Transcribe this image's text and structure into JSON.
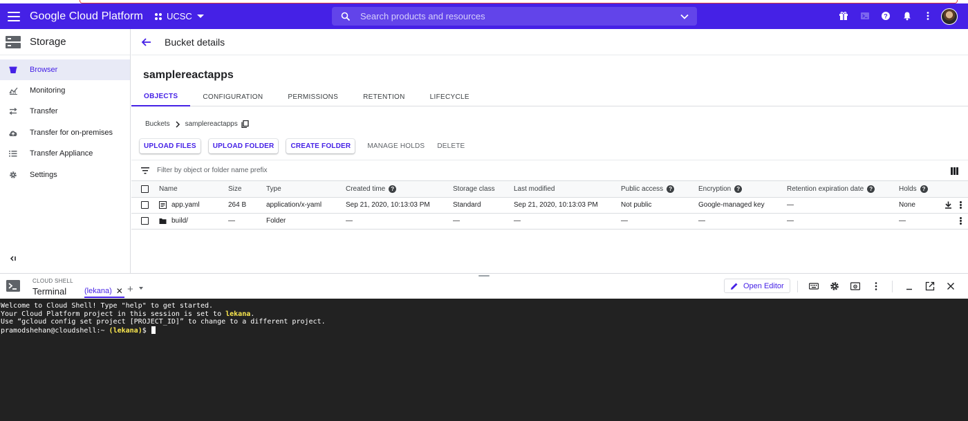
{
  "header": {
    "brand": "Google Cloud Platform",
    "project": "UCSC",
    "search_placeholder": "Search products and resources"
  },
  "sidebar": {
    "title": "Storage",
    "items": [
      {
        "label": "Browser",
        "icon": "bucket-icon",
        "active": true
      },
      {
        "label": "Monitoring",
        "icon": "chart-icon",
        "active": false
      },
      {
        "label": "Transfer",
        "icon": "transfer-icon",
        "active": false
      },
      {
        "label": "Transfer for on-premises",
        "icon": "cloud-upload-icon",
        "active": false
      },
      {
        "label": "Transfer Appliance",
        "icon": "list-icon",
        "active": false
      },
      {
        "label": "Settings",
        "icon": "gear-icon",
        "active": false
      }
    ]
  },
  "main": {
    "page_title": "Bucket details",
    "bucket_name": "samplereactapps",
    "tabs": [
      "OBJECTS",
      "CONFIGURATION",
      "PERMISSIONS",
      "RETENTION",
      "LIFECYCLE"
    ],
    "breadcrumb": {
      "root": "Buckets",
      "current": "samplereactapps"
    },
    "actions": {
      "upload_files": "UPLOAD FILES",
      "upload_folder": "UPLOAD FOLDER",
      "create_folder": "CREATE FOLDER",
      "manage_holds": "MANAGE HOLDS",
      "delete": "DELETE"
    },
    "filter_placeholder": "Filter by object or folder name prefix",
    "table": {
      "columns": {
        "name": "Name",
        "size": "Size",
        "type": "Type",
        "created": "Created time",
        "storage_class": "Storage class",
        "last_modified": "Last modified",
        "public_access": "Public access",
        "encryption": "Encryption",
        "retention": "Retention expiration date",
        "holds": "Holds"
      },
      "rows": [
        {
          "name": "app.yaml",
          "icon": "file-icon",
          "size": "264 B",
          "type": "application/x-yaml",
          "created": "Sep 21, 2020, 10:13:03 PM",
          "storage_class": "Standard",
          "last_modified": "Sep 21, 2020, 10:13:03 PM",
          "public_access": "Not public",
          "encryption": "Google-managed key",
          "retention": "—",
          "holds": "None"
        },
        {
          "name": "build/",
          "icon": "folder-icon",
          "size": "—",
          "type": "Folder",
          "created": "—",
          "storage_class": "—",
          "last_modified": "—",
          "public_access": "—",
          "encryption": "—",
          "retention": "—",
          "holds": "—"
        }
      ]
    }
  },
  "cloud_shell": {
    "caption": "CLOUD SHELL",
    "title": "Terminal",
    "tab_label": "(lekana)",
    "open_editor": "Open Editor",
    "terminal": {
      "line1": "Welcome to Cloud Shell! Type \"help\" to get started.",
      "line2_prefix": "Your Cloud Platform project in this session is set to ",
      "line2_project": "lekana",
      "line2_suffix": ".",
      "line3": "Use “gcloud config set project [PROJECT_ID]” to change to a different project.",
      "prompt_user": "pramodshehan@cloudshell:~ ",
      "prompt_project": "(lekana)",
      "prompt_symbol": "$ "
    }
  },
  "colors": {
    "brand": "#4521e6",
    "terminal_bg": "#222222",
    "terminal_highlight": "#fce94f"
  }
}
